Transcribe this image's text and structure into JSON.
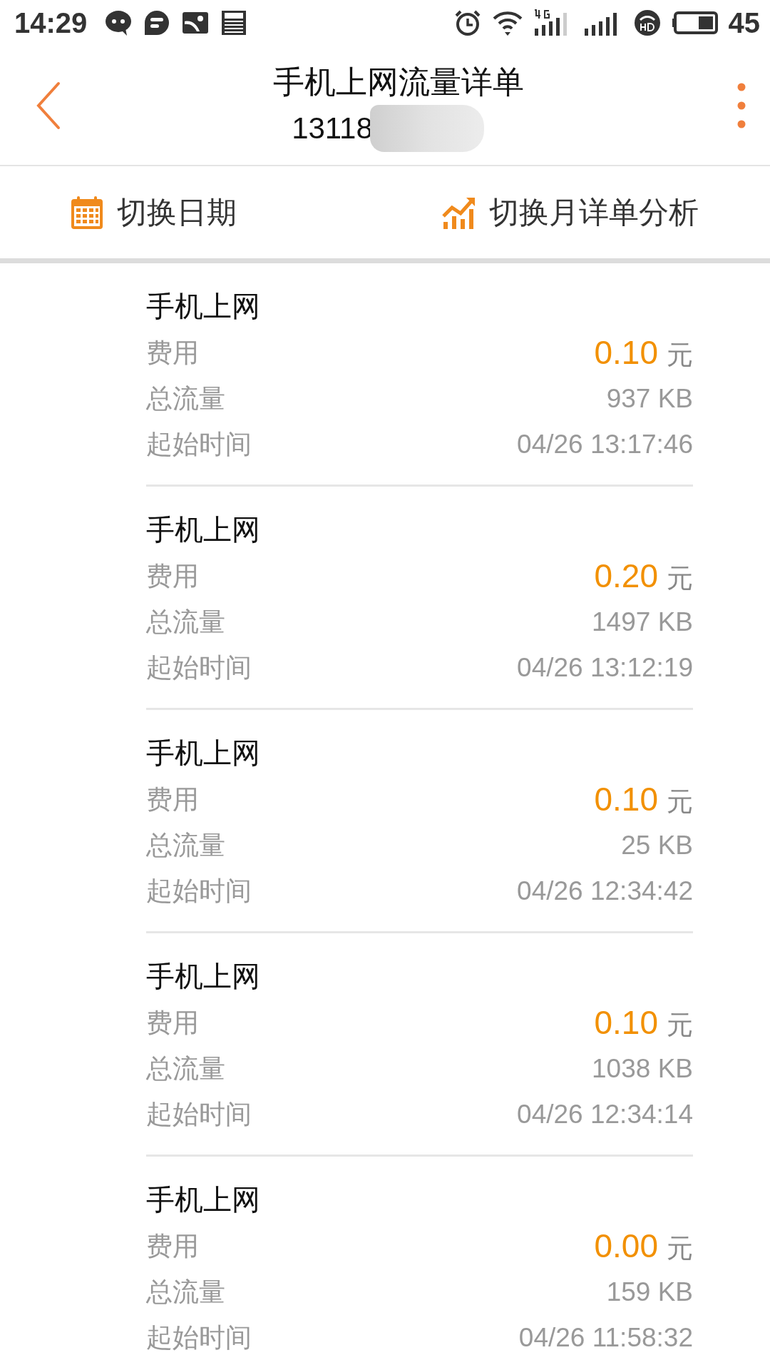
{
  "status_bar": {
    "time": "14:29",
    "battery": "45"
  },
  "header": {
    "title": "手机上网流量详单",
    "number": "13118"
  },
  "toolbar": [
    {
      "kind": "calendar",
      "label": "切换日期"
    },
    {
      "kind": "chart",
      "label": "切换月详单分析"
    }
  ],
  "records": [
    {
      "title": "手机上网",
      "fee_label": "费用",
      "fee": "0.10",
      "unit": "元",
      "traffic_label": "总流量",
      "traffic": "937 KB",
      "time_label": "起始时间",
      "time": "04/26 13:17:46"
    },
    {
      "title": "手机上网",
      "fee_label": "费用",
      "fee": "0.20",
      "unit": "元",
      "traffic_label": "总流量",
      "traffic": "1497 KB",
      "time_label": "起始时间",
      "time": "04/26 13:12:19"
    },
    {
      "title": "手机上网",
      "fee_label": "费用",
      "fee": "0.10",
      "unit": "元",
      "traffic_label": "总流量",
      "traffic": "25 KB",
      "time_label": "起始时间",
      "time": "04/26 12:34:42"
    },
    {
      "title": "手机上网",
      "fee_label": "费用",
      "fee": "0.10",
      "unit": "元",
      "traffic_label": "总流量",
      "traffic": "1038 KB",
      "time_label": "起始时间",
      "time": "04/26 12:34:14"
    },
    {
      "title": "手机上网",
      "fee_label": "费用",
      "fee": "0.00",
      "unit": "元",
      "traffic_label": "总流量",
      "traffic": "159 KB",
      "time_label": "起始时间",
      "time": "04/26 11:58:32"
    }
  ]
}
